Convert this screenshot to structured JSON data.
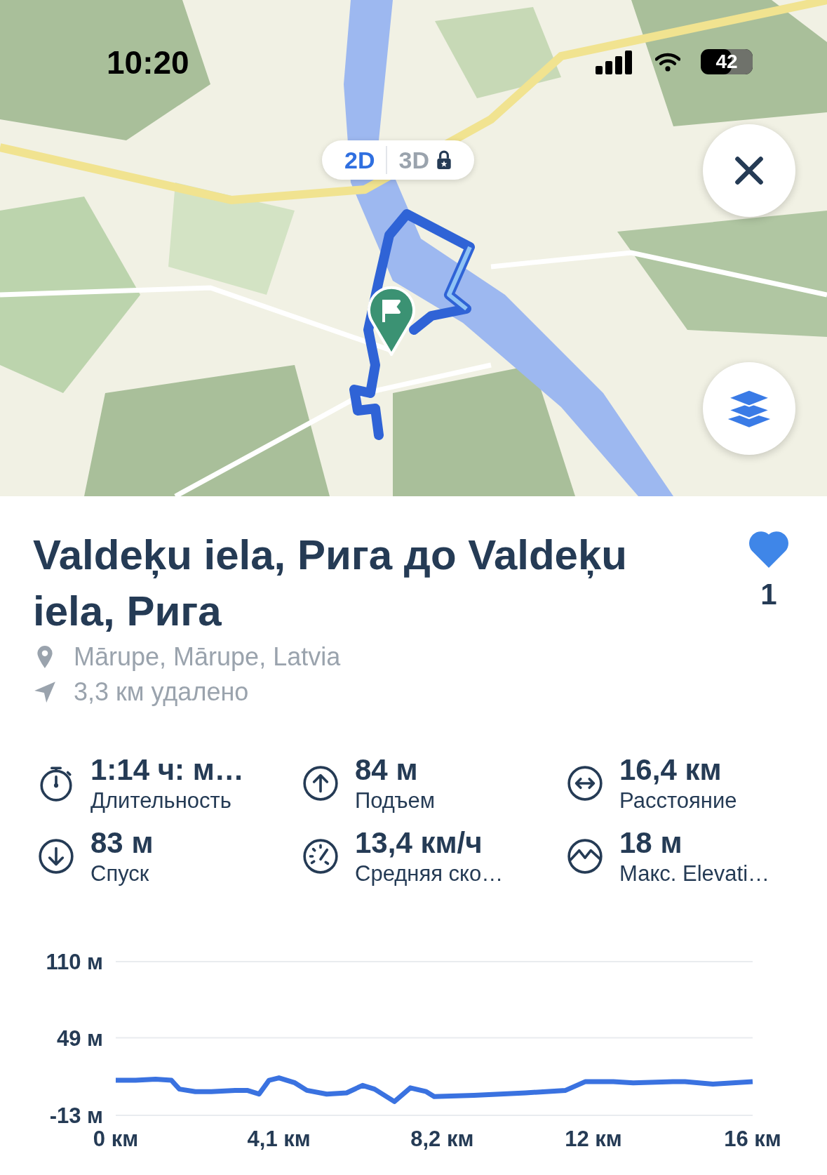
{
  "status_bar": {
    "time": "10:20",
    "battery": "42"
  },
  "map": {
    "kind": "picture",
    "view_toggle": [
      {
        "label": "2D",
        "selected": true,
        "locked": false
      },
      {
        "label": "3D",
        "selected": false,
        "locked": true
      }
    ]
  },
  "route": {
    "title": "Valdeķu iela, Рига до Valdeķu iela, Рига",
    "location": "Mārupe, Mārupe, Latvia",
    "distance_away": "3,3 км удалено",
    "liked": true,
    "likes": "1"
  },
  "stats": [
    {
      "kind": "duration",
      "value": "1:14  ч: м…",
      "label": "Длительность"
    },
    {
      "kind": "ascent",
      "value": "84 м",
      "label": "Подъем"
    },
    {
      "kind": "distance",
      "value": "16,4 км",
      "label": "Расстояние"
    },
    {
      "kind": "descent",
      "value": "83 м",
      "label": "Спуск"
    },
    {
      "kind": "speed",
      "value": "13,4 км/ч",
      "label": "Средняя ско…"
    },
    {
      "kind": "elevation",
      "value": "18 м",
      "label": "Макс. Elevati…"
    }
  ],
  "elevation_profile": {
    "chart_data": {
      "type": "line",
      "xlim": [
        0,
        16
      ],
      "ylim": [
        -13,
        110
      ],
      "xticks": [
        {
          "value": 0,
          "label": "0 км"
        },
        {
          "value": 4.1,
          "label": "4,1 км"
        },
        {
          "value": 8.2,
          "label": "8,2 км"
        },
        {
          "value": 12,
          "label": "12 км"
        },
        {
          "value": 16,
          "label": "16 км"
        }
      ],
      "yticks": [
        {
          "value": 110,
          "label": "110 м"
        },
        {
          "value": 49,
          "label": "49 м"
        },
        {
          "value": -13,
          "label": "-13 м"
        }
      ],
      "x": [
        0,
        0.5,
        1,
        1.4,
        1.6,
        2,
        2.4,
        3,
        3.3,
        3.6,
        3.85,
        4.1,
        4.5,
        4.8,
        5.3,
        5.8,
        6.2,
        6.5,
        7,
        7.4,
        7.8,
        8,
        9,
        10.3,
        11.3,
        11.8,
        12.5,
        13,
        14,
        14.3,
        15,
        16
      ],
      "series": [
        {
          "color": "#3a72e0",
          "values": [
            15,
            15,
            16,
            15,
            8,
            6,
            6,
            7,
            7,
            4,
            15,
            17,
            13,
            7,
            4,
            5,
            11,
            8,
            -2,
            9,
            6,
            2,
            3,
            5,
            7,
            14,
            14,
            13,
            14,
            14,
            12,
            14
          ]
        }
      ]
    }
  }
}
